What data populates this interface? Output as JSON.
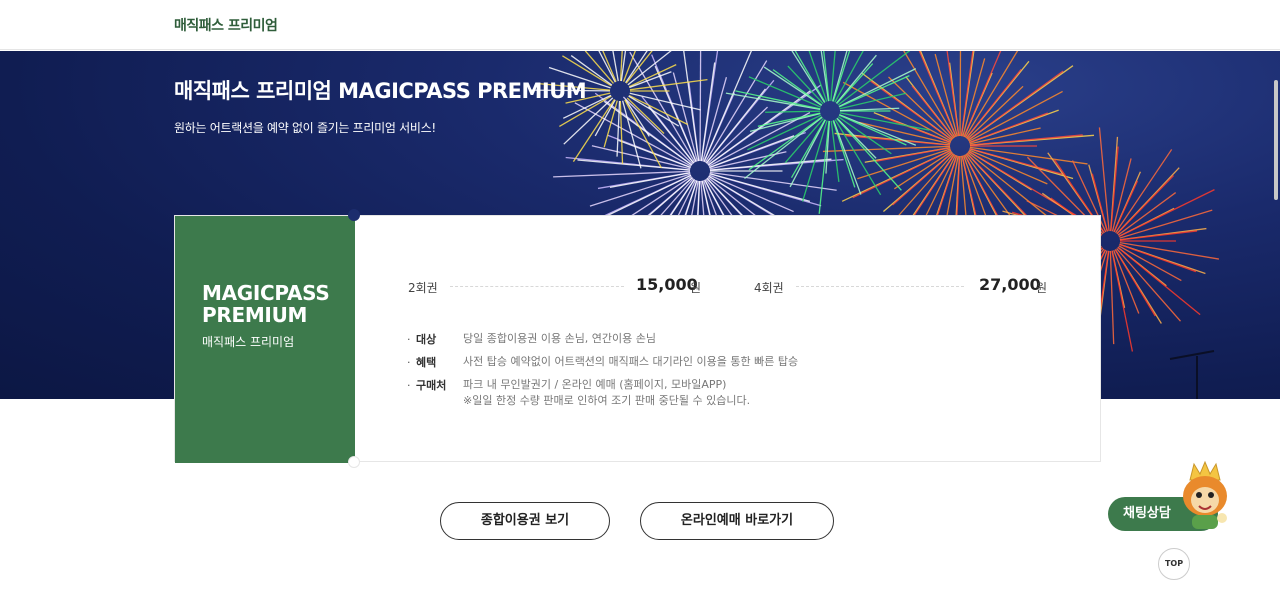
{
  "header": {
    "breadcrumb": "매직패스 프리미엄"
  },
  "hero": {
    "title": "매직패스 프리미엄 MAGICPASS PREMIUM",
    "subtitle": "원하는 어트랙션을 예약 없이 즐기는 프리미엄 서비스!"
  },
  "card": {
    "name_en_line1": "MAGICPASS",
    "name_en_line2": "PREMIUM",
    "name_ko": "매직패스 프리미엄",
    "prices": [
      {
        "label": "2회권",
        "amount": "15,000",
        "unit": "원"
      },
      {
        "label": "4회권",
        "amount": "27,000",
        "unit": "원"
      }
    ],
    "info": [
      {
        "key": "대상",
        "value": "당일 종합이용권 이용 손님, 연간이용 손님"
      },
      {
        "key": "혜택",
        "value": "사전 탑승 예약없이 어트랙션의 매직패스 대기라인 이용을 통한 빠른 탑승"
      },
      {
        "key": "구매처",
        "value": "파크 내 무인발권기 / 온라인 예매 (홈페이지, 모바일APP)",
        "note": "※일일 한정 수량 판매로 인하여 조기 판매 중단될 수 있습니다."
      }
    ],
    "bullet": "·"
  },
  "buttons": {
    "ticket_label": "종합이용권 보기",
    "online_label": "온라인예매 바로가기"
  },
  "floating": {
    "chat_label": "채팅상담",
    "top_label": "TOP"
  },
  "colors": {
    "brand_green": "#3d7a4c",
    "hero_navy": "#1a2a6c"
  }
}
